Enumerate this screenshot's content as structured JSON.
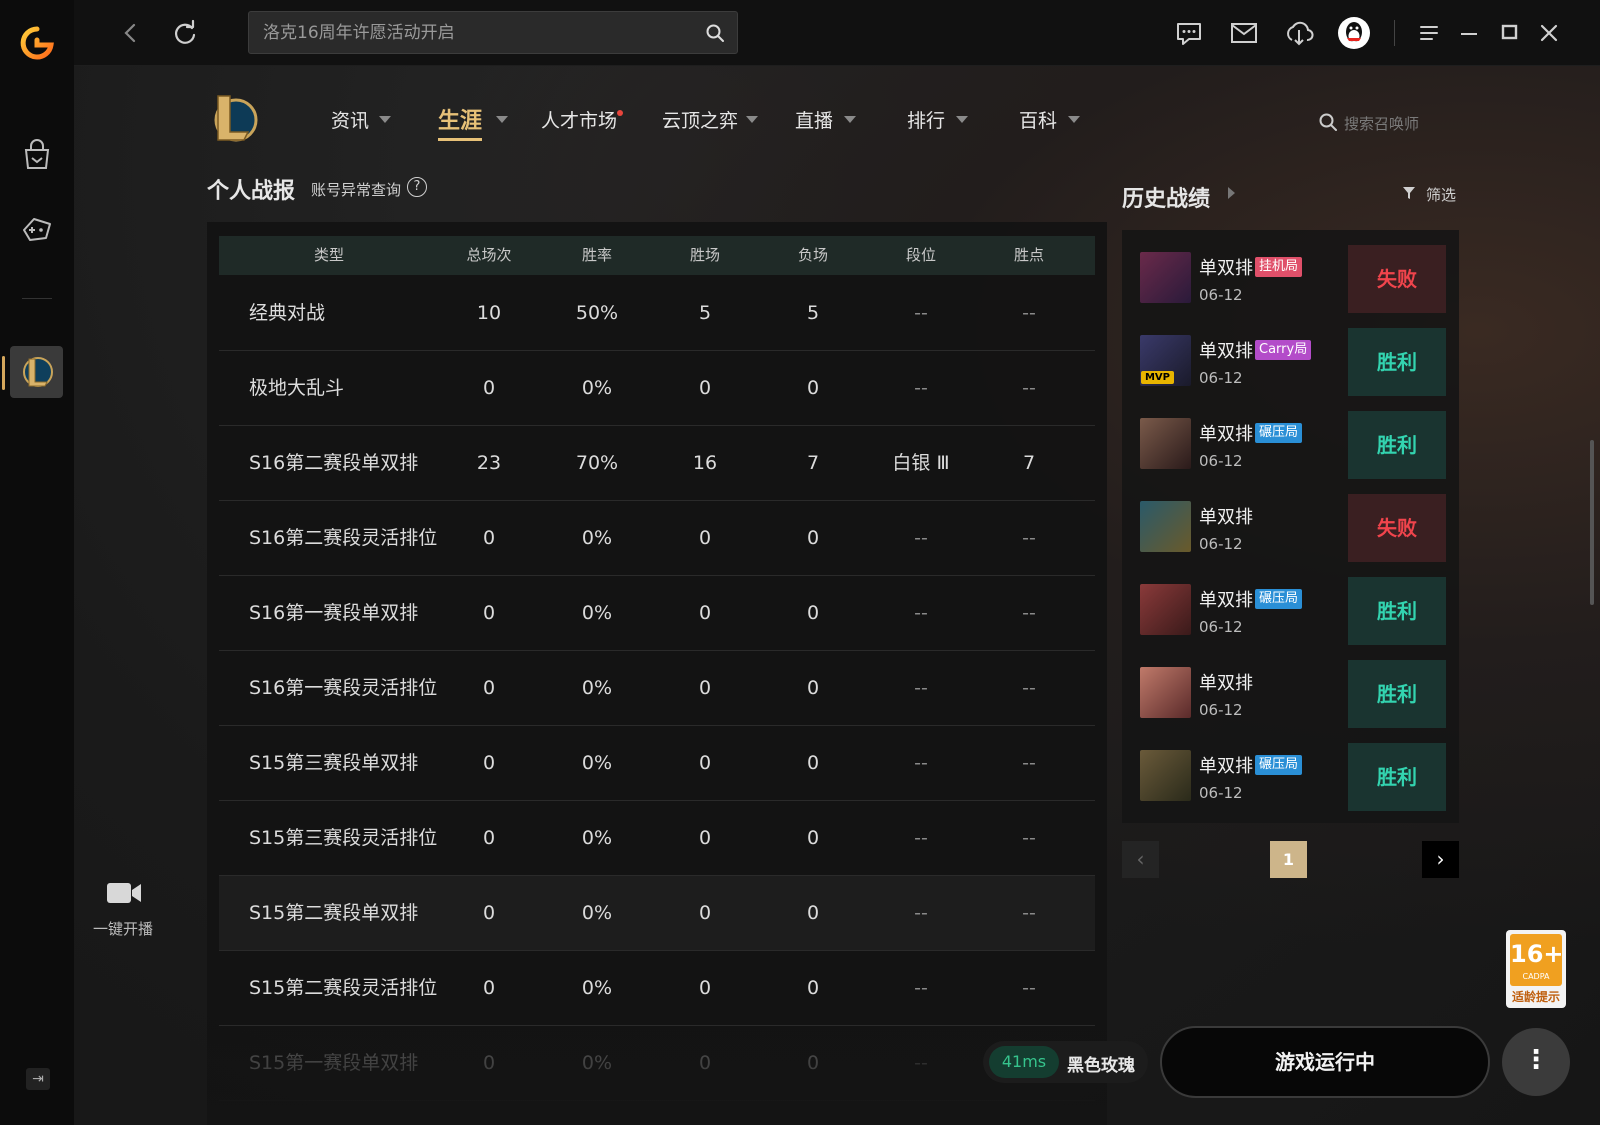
{
  "titlebar": {
    "search_placeholder": "洛克16周年许愿活动开启"
  },
  "game_nav": {
    "items": [
      {
        "label": "资讯"
      },
      {
        "label": "生涯"
      },
      {
        "label": "人才市场"
      },
      {
        "label": "云顶之弈"
      },
      {
        "label": "直播"
      },
      {
        "label": "排行"
      },
      {
        "label": "百科"
      }
    ],
    "summoner_search_placeholder": "搜索召唤师"
  },
  "stats": {
    "title": "个人战报",
    "account_check": "账号异常查询",
    "help": "?",
    "columns": [
      "类型",
      "总场次",
      "胜率",
      "胜场",
      "负场",
      "段位",
      "胜点"
    ],
    "rows": [
      {
        "type": "经典对战",
        "total": "10",
        "rate": "50%",
        "wins": "5",
        "losses": "5",
        "rank": "--",
        "lp": "--"
      },
      {
        "type": "极地大乱斗",
        "total": "0",
        "rate": "0%",
        "wins": "0",
        "losses": "0",
        "rank": "--",
        "lp": "--"
      },
      {
        "type": "S16第二赛段单双排",
        "total": "23",
        "rate": "70%",
        "wins": "16",
        "losses": "7",
        "rank": "白银 Ⅲ",
        "lp": "7"
      },
      {
        "type": "S16第二赛段灵活排位",
        "total": "0",
        "rate": "0%",
        "wins": "0",
        "losses": "0",
        "rank": "--",
        "lp": "--"
      },
      {
        "type": "S16第一赛段单双排",
        "total": "0",
        "rate": "0%",
        "wins": "0",
        "losses": "0",
        "rank": "--",
        "lp": "--"
      },
      {
        "type": "S16第一赛段灵活排位",
        "total": "0",
        "rate": "0%",
        "wins": "0",
        "losses": "0",
        "rank": "--",
        "lp": "--"
      },
      {
        "type": "S15第三赛段单双排",
        "total": "0",
        "rate": "0%",
        "wins": "0",
        "losses": "0",
        "rank": "--",
        "lp": "--"
      },
      {
        "type": "S15第三赛段灵活排位",
        "total": "0",
        "rate": "0%",
        "wins": "0",
        "losses": "0",
        "rank": "--",
        "lp": "--"
      },
      {
        "type": "S15第二赛段单双排",
        "total": "0",
        "rate": "0%",
        "wins": "0",
        "losses": "0",
        "rank": "--",
        "lp": "--"
      },
      {
        "type": "S15第二赛段灵活排位",
        "total": "0",
        "rate": "0%",
        "wins": "0",
        "losses": "0",
        "rank": "--",
        "lp": "--"
      },
      {
        "type": "S15第一赛段单双排",
        "total": "0",
        "rate": "0%",
        "wins": "0",
        "losses": "0",
        "rank": "--",
        "lp": "--"
      }
    ]
  },
  "history": {
    "title": "历史战绩",
    "filter_label": "筛选",
    "matches": [
      {
        "mode": "单双排",
        "tag": "挂机局",
        "tag_color": "#e0506a",
        "date": "06-12",
        "result": "失败",
        "outcome": "lose",
        "mvp": ""
      },
      {
        "mode": "单双排",
        "tag": "Carry局",
        "tag_color": "#b34cc9",
        "date": "06-12",
        "result": "胜利",
        "outcome": "win",
        "mvp": "MVP"
      },
      {
        "mode": "单双排",
        "tag": "碾压局",
        "tag_color": "#2a8fd6",
        "date": "06-12",
        "result": "胜利",
        "outcome": "win",
        "mvp": ""
      },
      {
        "mode": "单双排",
        "tag": "",
        "tag_color": "",
        "date": "06-12",
        "result": "失败",
        "outcome": "lose",
        "mvp": ""
      },
      {
        "mode": "单双排",
        "tag": "碾压局",
        "tag_color": "#2a8fd6",
        "date": "06-12",
        "result": "胜利",
        "outcome": "win",
        "mvp": ""
      },
      {
        "mode": "单双排",
        "tag": "",
        "tag_color": "",
        "date": "06-12",
        "result": "胜利",
        "outcome": "win",
        "mvp": ""
      },
      {
        "mode": "单双排",
        "tag": "碾压局",
        "tag_color": "#2a8fd6",
        "date": "06-12",
        "result": "胜利",
        "outcome": "win",
        "mvp": ""
      }
    ],
    "pager": {
      "prev": "‹",
      "page": "1",
      "next": "›"
    }
  },
  "sidebar": {
    "broadcast_label": "一键开播"
  },
  "bottom": {
    "ping": "41ms",
    "server": "黑色玫瑰",
    "launch_label": "游戏运行中",
    "more": "⋮"
  },
  "age_rating": {
    "rating": "16+",
    "org": "CADPA",
    "note": "适龄提示"
  },
  "colors": {
    "accent_gold": "#e7c178",
    "win": "#33d4b0",
    "lose": "#f0444c"
  }
}
